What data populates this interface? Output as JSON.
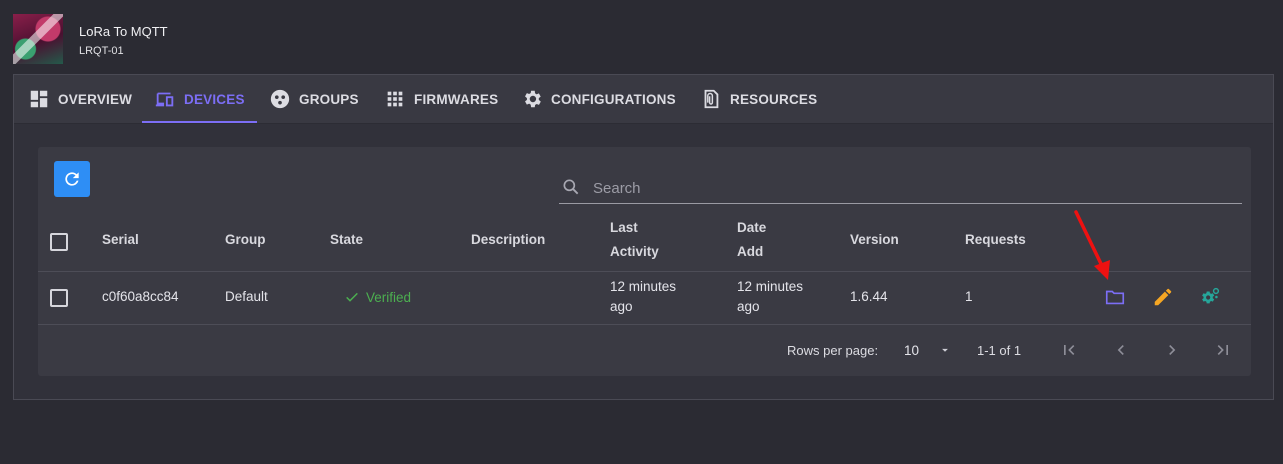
{
  "header": {
    "title": "LoRa To MQTT",
    "subtitle": "LRQT-01"
  },
  "tabs": [
    {
      "label": "OVERVIEW",
      "icon": "dashboard-icon"
    },
    {
      "label": "DEVICES",
      "icon": "devices-icon",
      "active": true
    },
    {
      "label": "GROUPS",
      "icon": "groups-icon"
    },
    {
      "label": "FIRMWARES",
      "icon": "grid-icon"
    },
    {
      "label": "CONFIGURATIONS",
      "icon": "gear-icon"
    },
    {
      "label": "RESOURCES",
      "icon": "attachment-file-icon"
    }
  ],
  "toolbar": {
    "refresh_icon": "refresh-icon"
  },
  "search": {
    "placeholder": "Search",
    "value": ""
  },
  "table": {
    "columns": {
      "serial": "Serial",
      "group": "Group",
      "state": "State",
      "description": "Description",
      "last_activity_1": "Last",
      "last_activity_2": "Activity",
      "date_add_1": "Date",
      "date_add_2": "Add",
      "version": "Version",
      "requests": "Requests"
    },
    "rows": [
      {
        "serial": "c0f60a8cc84",
        "group": "Default",
        "state": "Verified",
        "description": "",
        "last_activity_1": "12 minutes",
        "last_activity_2": "ago",
        "date_add_1": "12 minutes",
        "date_add_2": "ago",
        "version": "1.6.44",
        "requests": "1",
        "actions": [
          "folder-icon",
          "pencil-icon",
          "settings-cogs-icon"
        ]
      }
    ]
  },
  "footer": {
    "rows_per_page_label": "Rows per page:",
    "rows_per_page_value": "10",
    "range": "1-1 of 1"
  },
  "colors": {
    "accent": "#7c6ef5",
    "refresh": "#2e8ef5",
    "verified": "#4caf50",
    "edit": "#f5a623",
    "settings": "#26a69a",
    "annotation": "#ee1111"
  }
}
